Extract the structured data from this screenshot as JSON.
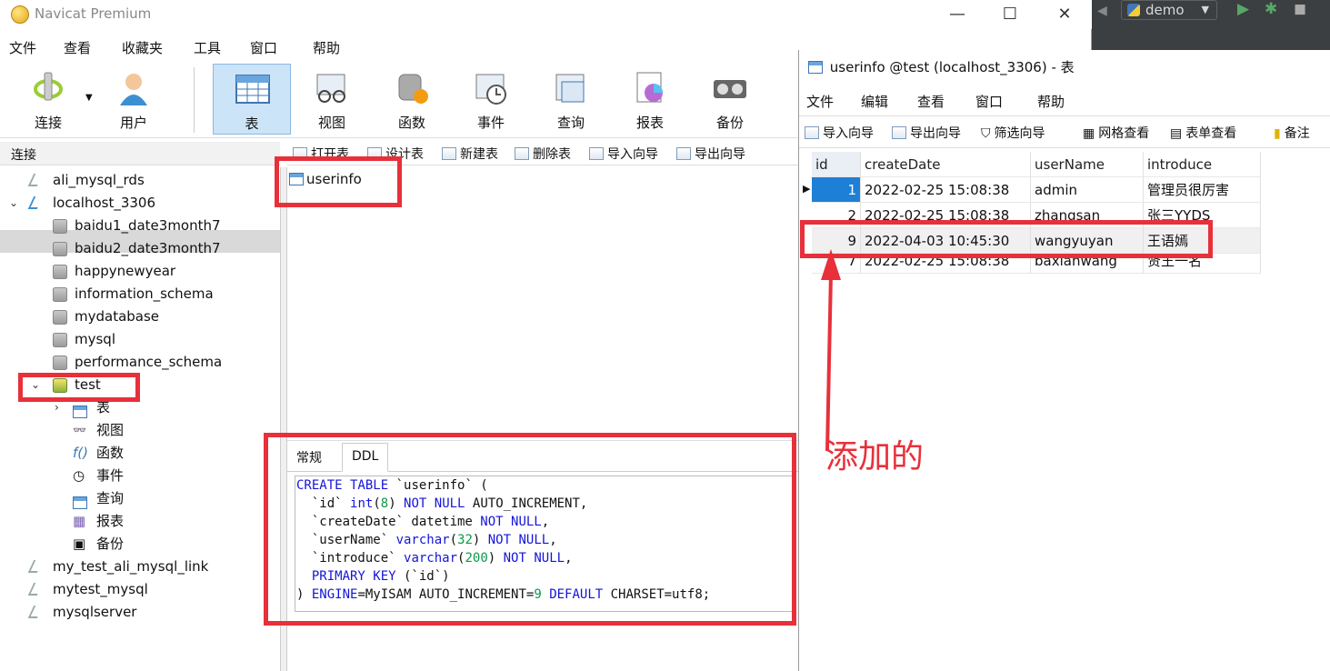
{
  "ide": {
    "run_config": "demo"
  },
  "app": {
    "title": "Navicat Premium"
  },
  "menu": [
    "文件",
    "查看",
    "收藏夹",
    "工具",
    "窗口",
    "帮助"
  ],
  "toolbar": [
    {
      "label": "连接",
      "icon": "connect-icon"
    },
    {
      "label": "用户",
      "icon": "user-icon"
    },
    {
      "label": "表",
      "icon": "table-icon"
    },
    {
      "label": "视图",
      "icon": "view-icon"
    },
    {
      "label": "函数",
      "icon": "function-icon"
    },
    {
      "label": "事件",
      "icon": "event-icon"
    },
    {
      "label": "查询",
      "icon": "query-icon"
    },
    {
      "label": "报表",
      "icon": "report-icon"
    },
    {
      "label": "备份",
      "icon": "backup-icon"
    }
  ],
  "sidebar": {
    "header": "连接",
    "connections": [
      {
        "name": "ali_mysql_rds"
      },
      {
        "name": "localhost_3306"
      },
      {
        "name": "my_test_ali_mysql_link"
      },
      {
        "name": "mytest_mysql"
      },
      {
        "name": "mysqlserver"
      }
    ],
    "databases": [
      "baidu1_date3month7",
      "baidu2_date3month7",
      "happynewyear",
      "information_schema",
      "mydatabase",
      "mysql",
      "performance_schema",
      "test"
    ],
    "test_children": [
      "表",
      "视图",
      "函数",
      "事件",
      "查询",
      "报表",
      "备份"
    ]
  },
  "object_toolbar": [
    "打开表",
    "设计表",
    "新建表",
    "删除表",
    "导入向导",
    "导出向导"
  ],
  "objects": [
    "userinfo"
  ],
  "ddl": {
    "tabs": [
      "常规",
      "DDL"
    ]
  },
  "table_window": {
    "title": "userinfo @test (localhost_3306) - 表",
    "menu": [
      "文件",
      "编辑",
      "查看",
      "窗口",
      "帮助"
    ],
    "toolbar": [
      "导入向导",
      "导出向导",
      "筛选向导",
      "网格查看",
      "表单查看",
      "备注"
    ],
    "columns": [
      "id",
      "createDate",
      "userName",
      "introduce"
    ],
    "rows": [
      [
        "1",
        "2022-02-25 15:08:38",
        "admin",
        "管理员很厉害"
      ],
      [
        "2",
        "2022-02-25 15:08:38",
        "zhangsan",
        "张三YYDS"
      ],
      [
        "9",
        "2022-04-03 10:45:30",
        "wangyuyan",
        "王语嫣"
      ],
      [
        "7",
        "2022-02-25 15:08:38",
        "baxianwang",
        "贤王一名"
      ]
    ]
  },
  "annotation": {
    "text": "添加的",
    "color": "#e8303a"
  },
  "colors": {
    "selection": "#1e7fd6",
    "toolbar_active": "#cce4f7",
    "annotation": "#e8303a"
  }
}
